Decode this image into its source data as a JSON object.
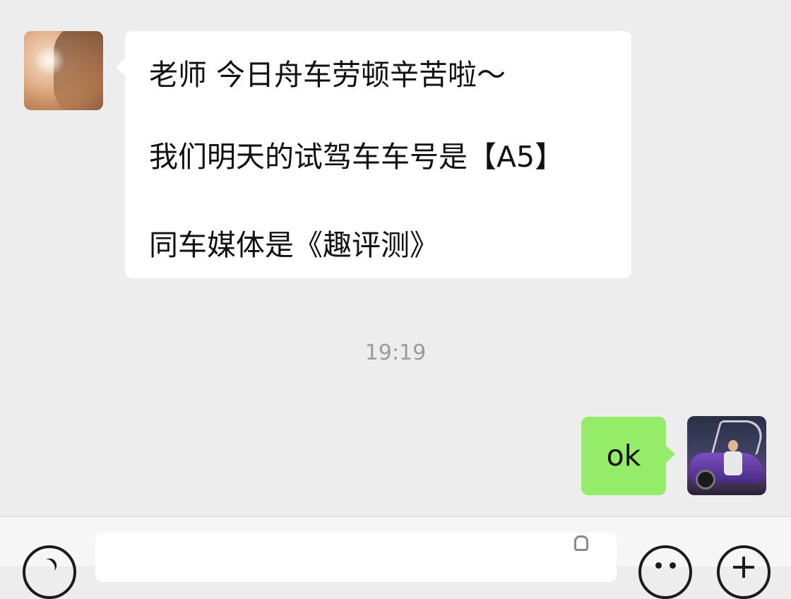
{
  "messages": [
    {
      "direction": "incoming",
      "avatar": "contact-avatar-photo",
      "lines": [
        "老师 今日舟车劳顿辛苦啦～",
        "我们明天的试驾车车号是【A5】",
        "同车媒体是《趣评测》"
      ]
    },
    {
      "direction": "outgoing",
      "avatar": "user-avatar-photo",
      "text": "ok"
    }
  ],
  "timestamp": "19:19",
  "input_bar": {
    "value": "",
    "icons": [
      "voice-icon",
      "microphone-icon",
      "emoji-icon",
      "plus-icon"
    ]
  },
  "colors": {
    "background": "#ededed",
    "incoming_bubble": "#ffffff",
    "outgoing_bubble": "#95ec69",
    "timestamp": "#9b9b9b"
  }
}
